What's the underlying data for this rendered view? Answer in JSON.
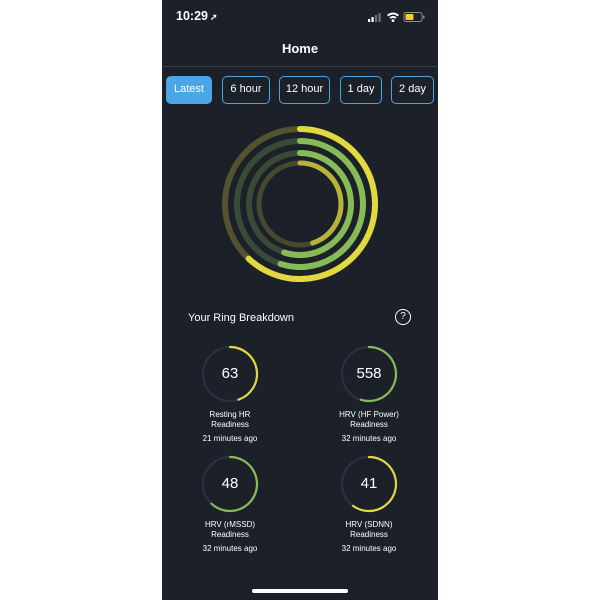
{
  "status_bar": {
    "time": "10:29",
    "location_icon": "location-arrow-icon",
    "signal_icon": "signal-icon",
    "wifi_icon": "wifi-icon",
    "battery_icon": "battery-icon",
    "battery_color": "#f5d020"
  },
  "header": {
    "title": "Home"
  },
  "range_tabs": [
    {
      "label": "Latest",
      "selected": true
    },
    {
      "label": "6 hour",
      "selected": false
    },
    {
      "label": "12 hour",
      "selected": false
    },
    {
      "label": "1 day",
      "selected": false
    },
    {
      "label": "2 day",
      "selected": false
    }
  ],
  "rings": [
    {
      "name": "HRV (SDNN) Readiness",
      "value": 41,
      "progress": 0.62,
      "color": "#e2d840"
    },
    {
      "name": "HRV (HF Power) Readiness",
      "value": 558,
      "progress": 0.55,
      "color": "#86bb58"
    },
    {
      "name": "HRV (rMSSD) Readiness",
      "value": 48,
      "progress": 0.55,
      "color": "#86bb58"
    },
    {
      "name": "Resting HR Readiness",
      "value": 63,
      "progress": 0.45,
      "color": "#b8b439"
    }
  ],
  "breakdown": {
    "title": "Your Ring Breakdown",
    "help_label": "?",
    "metrics": [
      {
        "value": "63",
        "label_line1": "Resting HR",
        "label_line2": "Readiness",
        "ago": "21 minutes ago",
        "progress": 0.45,
        "color": "#e2d840"
      },
      {
        "value": "558",
        "label_line1": "HRV (HF Power)",
        "label_line2": "Readiness",
        "ago": "32 minutes ago",
        "progress": 0.55,
        "color": "#86bb58"
      },
      {
        "value": "48",
        "label_line1": "HRV (rMSSD)",
        "label_line2": "Readiness",
        "ago": "32 minutes ago",
        "progress": 0.62,
        "color": "#86bb58"
      },
      {
        "value": "41",
        "label_line1": "HRV (SDNN)",
        "label_line2": "Readiness",
        "ago": "32 minutes ago",
        "progress": 0.6,
        "color": "#e2d840"
      }
    ]
  },
  "colors": {
    "background": "#1b2029",
    "accent": "#4aa6e6",
    "track": "#2a3146"
  }
}
